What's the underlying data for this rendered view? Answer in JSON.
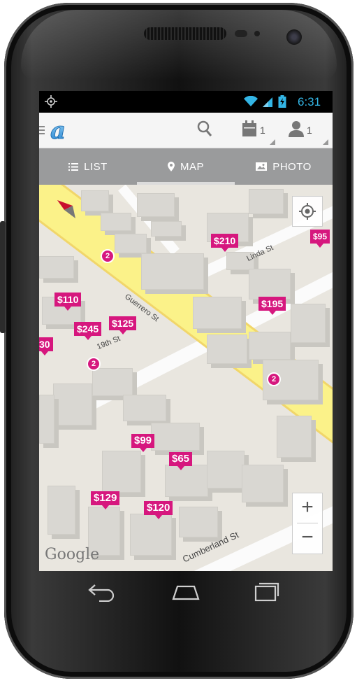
{
  "statusbar": {
    "time": "6:31",
    "icons": [
      "location-icon",
      "wifi-icon",
      "signal-icon",
      "battery-icon"
    ],
    "accent_color": "#33b5e5"
  },
  "actionbar": {
    "logo_letter": "a",
    "calendar_count": "1",
    "guests_count": "1",
    "icons": [
      "menu-icon",
      "search-icon",
      "calendar-icon",
      "person-icon"
    ]
  },
  "tabs": [
    {
      "label": "LIST",
      "icon": "list-icon",
      "selected": false
    },
    {
      "label": "MAP",
      "icon": "map-pin-icon",
      "selected": true
    },
    {
      "label": "PHOTO",
      "icon": "photo-icon",
      "selected": false
    }
  ],
  "map": {
    "streets": {
      "guerrero": "Guerrero St",
      "linda": "Linda St",
      "nineteenth": "19th St",
      "cumberland": "Cumberland St"
    },
    "price_pins": [
      "$210",
      "$95",
      "$110",
      "$245",
      "$125",
      "$195",
      "30",
      "$99",
      "$65",
      "$129",
      "$120"
    ],
    "cluster_counts": [
      "2",
      "2",
      "2"
    ],
    "zoom_in_label": "+",
    "zoom_out_label": "−",
    "attribution": "Google",
    "pin_color": "#d6177e",
    "road_color": "#fbf289"
  },
  "navbar": {
    "icons": [
      "back-icon",
      "home-icon",
      "recents-icon"
    ]
  }
}
